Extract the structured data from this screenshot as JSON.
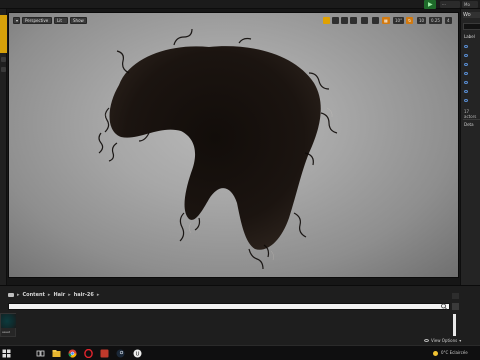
{
  "colors": {
    "accent_orange": "#e0a100",
    "viewport_bg": "#a7a7a7",
    "play_green": "#1e6b2a",
    "eye_blue": "#5a8fd6"
  },
  "topbar": {
    "pill_a": "···",
    "pill_b": "Mo",
    "play_icon": "play-icon"
  },
  "viewport": {
    "perspective_label": "Perspective",
    "lit_label": "Lit",
    "show_label": "Show",
    "grid_value": "10°",
    "rotation_value": "10",
    "scale_value": "0.25",
    "camera_value": "4"
  },
  "outliner": {
    "header": "Wo",
    "column_label": "Label",
    "count_text": "17 actors",
    "details_label": "Deta"
  },
  "content_browser": {
    "path": [
      "Content",
      "Hair",
      "hair-26"
    ],
    "thumb_label": "asset",
    "view_options": "View Options"
  },
  "taskbar": {
    "tray_text": "0°C  Eclaircée"
  }
}
